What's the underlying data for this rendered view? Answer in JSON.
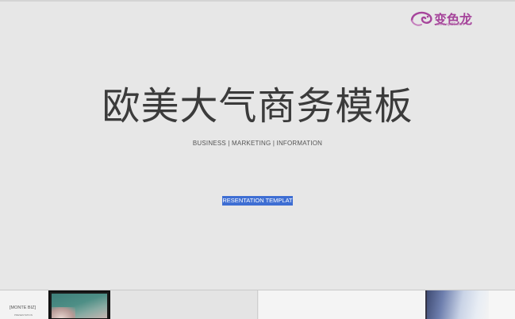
{
  "slide": {
    "logo": {
      "name": "变色龙",
      "url": "www.apt86.com",
      "brand_color": "#a6459b"
    },
    "title": "欧美大气商务模板",
    "subtitle": "BUSINESS | MARKETING | INFORMATION",
    "selected_text": "RESENTATION TEMPLAT",
    "selection_color": "#3e6ed3"
  },
  "thumbnails": [
    {
      "name": "[MONTE BIZ]",
      "subtext": "PRESENTATION"
    }
  ]
}
